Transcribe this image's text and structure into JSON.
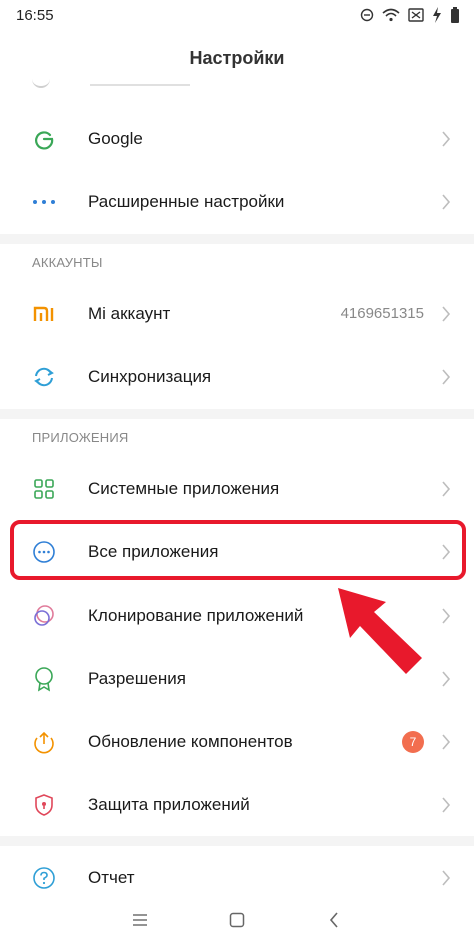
{
  "status_bar": {
    "time": "16:55"
  },
  "header": {
    "title": "Настройки"
  },
  "rows_top": [
    {
      "label": "Google",
      "icon": "google-icon"
    },
    {
      "label": "Расширенные настройки",
      "icon": "more-dots-icon"
    }
  ],
  "accounts": {
    "section_title": "АККАУНТЫ",
    "mi": {
      "label": "Mi аккаунт",
      "value": "4169651315",
      "icon": "mi-logo-icon"
    },
    "sync": {
      "label": "Синхронизация",
      "icon": "sync-icon"
    }
  },
  "apps": {
    "section_title": "ПРИЛОЖЕНИЯ",
    "items": [
      {
        "label": "Системные приложения",
        "icon": "grid-icon"
      },
      {
        "label": "Все приложения",
        "icon": "all-apps-icon"
      },
      {
        "label": "Клонирование приложений",
        "icon": "clone-icon"
      },
      {
        "label": "Разрешения",
        "icon": "permissions-icon"
      },
      {
        "label": "Обновление компонентов",
        "icon": "update-icon",
        "badge": "7"
      },
      {
        "label": "Защита приложений",
        "icon": "shield-icon"
      }
    ]
  },
  "report": {
    "label": "Отчет",
    "icon": "help-icon"
  },
  "colors": {
    "highlight": "#e8192c",
    "mi_orange": "#f39200",
    "badge": "#f26e4f"
  }
}
